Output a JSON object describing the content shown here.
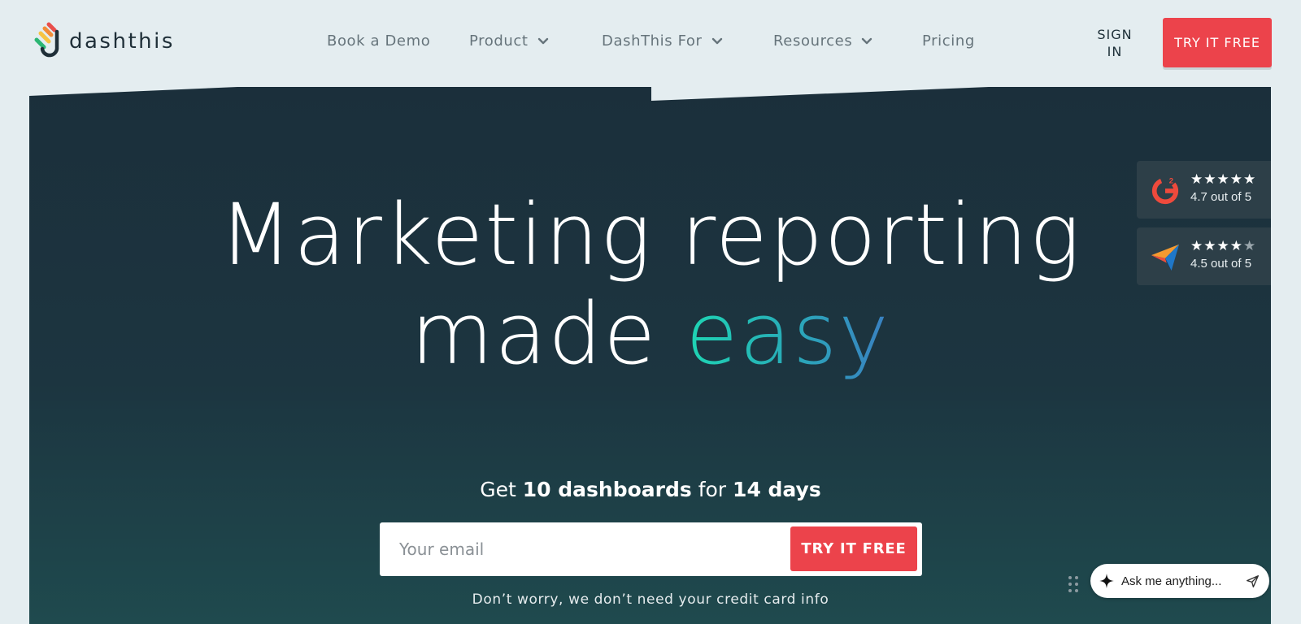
{
  "brand": {
    "name": "dashthis"
  },
  "nav": {
    "items": [
      {
        "label": "Book a Demo",
        "has_dropdown": false
      },
      {
        "label": "Product",
        "has_dropdown": true
      },
      {
        "label": "DashThis For",
        "has_dropdown": true
      },
      {
        "label": "Resources",
        "has_dropdown": true
      },
      {
        "label": "Pricing",
        "has_dropdown": false
      }
    ],
    "sign_in_label": "SIGN IN",
    "try_label": "TRY IT FREE"
  },
  "hero": {
    "headline_line1": "Marketing reporting",
    "headline_line2_prefix": "made ",
    "headline_highlight": "easy",
    "offer": {
      "prefix": "Get ",
      "dashboards": "10 dashboards",
      "middle": " for ",
      "days": "14 days"
    },
    "email_placeholder": "Your email",
    "cta_label": "TRY IT FREE",
    "note": "Don’t worry, we don’t need your credit card info"
  },
  "ratings": [
    {
      "source_icon": "g2-logo-icon",
      "stars": "★★★★★",
      "dim_stars": "",
      "score_text": "4.7 out of 5",
      "score": 4.7
    },
    {
      "source_icon": "capterra-logo-icon",
      "stars": "★★★★",
      "dim_stars": "★",
      "score_text": "4.5 out of 5",
      "score": 4.5
    }
  ],
  "chat": {
    "placeholder": "Ask me anything...",
    "icons": [
      "sparkle-icon",
      "send-icon",
      "drag-handle-icon"
    ]
  },
  "colors": {
    "accent_red": "#ec434b",
    "hero_dark": "#1b2f3b",
    "page_bg": "#e4edf0",
    "easy_gradient_start": "#1ed6b4",
    "easy_gradient_end": "#3a7fc2"
  }
}
